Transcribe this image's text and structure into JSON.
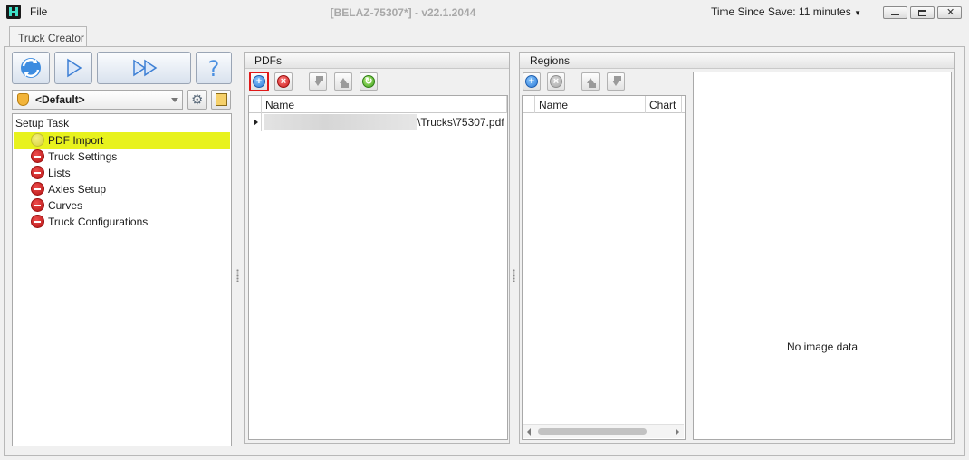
{
  "titlebar": {
    "file_menu": "File",
    "title": "[BELAZ-75307*]  -  v22.1.2044",
    "save_timer": "Time Since Save: 11 minutes"
  },
  "tabs": [
    {
      "label": "Truck Creator"
    }
  ],
  "left_panel": {
    "profile": {
      "selected": "<Default>"
    },
    "task_header": "Setup Task",
    "tasks": [
      {
        "label": "PDF Import",
        "status": "pending",
        "selected": true
      },
      {
        "label": "Truck Settings",
        "status": "error"
      },
      {
        "label": "Lists",
        "status": "error"
      },
      {
        "label": "Axles Setup",
        "status": "error"
      },
      {
        "label": "Curves",
        "status": "error"
      },
      {
        "label": "Truck Configurations",
        "status": "error"
      }
    ]
  },
  "pdfs_panel": {
    "title": "PDFs",
    "columns": [
      "Name"
    ],
    "rows": [
      {
        "name": "\\Trucks\\75307.pdf"
      }
    ]
  },
  "regions_panel": {
    "title": "Regions",
    "columns": [
      "Name",
      "Chart"
    ],
    "preview_message": "No image data"
  },
  "colors": {
    "selected_row": "#e8f21d",
    "add_button_highlight": "#e01818"
  }
}
